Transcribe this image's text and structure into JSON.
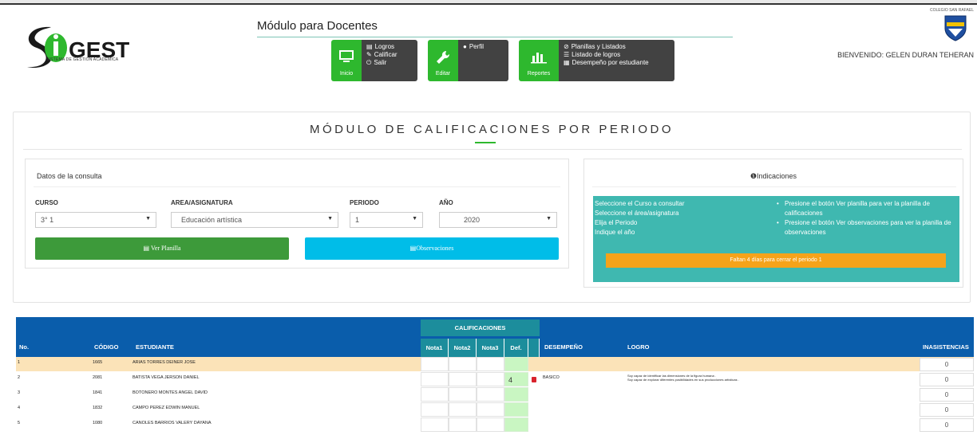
{
  "brand": {
    "logo_text": "SIGEST",
    "logo_sub": "SISTEMA DE GESTION ACADEMICA",
    "college": "COLEGIO SAN RAFAEL"
  },
  "header": {
    "module_title": "Módulo para Docentes",
    "welcome": "BIENVENIDO: GELEN DURAN TEHERAN"
  },
  "nav": {
    "inicio": {
      "label": "Inicio",
      "items": [
        "Logros",
        "Calificar",
        "Salir"
      ]
    },
    "editar": {
      "label": "Editar",
      "items": [
        "Perfil"
      ]
    },
    "reportes": {
      "label": "Reportes",
      "items": [
        "Planillas y Listados",
        "Listado de logros",
        "Desempeño por estudiante"
      ]
    }
  },
  "page": {
    "title": "MÓDULO DE CALIFICACIONES POR PERIODO"
  },
  "query": {
    "title": "Datos de la consulta",
    "curso_label": "CURSO",
    "curso_value": "3° 1",
    "area_label": "AREA/ASIGNATURA",
    "area_value": "Educación artística",
    "periodo_label": "PERIODO",
    "periodo_value": "1",
    "anio_label": "AÑO",
    "anio_value": "2020",
    "ver_planilla": "Ver Planilla",
    "observaciones": "Observaciones"
  },
  "indications": {
    "title": "Indicaciones",
    "left": [
      "Seleccione el Curso a consultar",
      "Seleccione el área/asignatura",
      "Elija el Periodo",
      "Indique el año"
    ],
    "right": [
      "Presione el botón Ver planilla para ver la planilla de calificaciones",
      "Presione el botón Ver observaciones para ver la planilla de observaciones"
    ],
    "alert": "Faltan 4 días para cerrar el periodo 1"
  },
  "table": {
    "calificaciones": "CALIFICACIONES",
    "headers": {
      "no": "No.",
      "codigo": "CÓDIGO",
      "estudiante": "ESTUDIANTE",
      "nota1": "Nota1",
      "nota2": "Nota2",
      "nota3": "Nota3",
      "def": "Def.",
      "desempeno": "DESEMPEÑO",
      "logro": "LOGRO",
      "inasistencias": "INASISTENCIAS"
    },
    "rows": [
      {
        "no": "1",
        "codigo": "1665",
        "estudiante": "ARIAS TORRES DEINER JOSE",
        "def": "",
        "desempeno": "",
        "logro1": "",
        "logro2": "",
        "inasistencias": "0"
      },
      {
        "no": "2",
        "codigo": "2081",
        "estudiante": "BATISTA VEGA JERSON DANIEL",
        "def": "4",
        "desempeno": "BASICO",
        "logro1": "Soy capaz de identificar las dimensiones de la figura humana .",
        "logro2": "Soy capaz de explorar diferentes posibilidades en sus producciones artísticas .",
        "inasistencias": "0"
      },
      {
        "no": "3",
        "codigo": "1841",
        "estudiante": "BOTONERO MONTES ANGEL DAVID",
        "def": "",
        "desempeno": "",
        "logro1": "",
        "logro2": "",
        "inasistencias": "0"
      },
      {
        "no": "4",
        "codigo": "1832",
        "estudiante": "CAMPO PEREZ EDWIN MANUEL",
        "def": "",
        "desempeno": "",
        "logro1": "",
        "logro2": "",
        "inasistencias": "0"
      },
      {
        "no": "5",
        "codigo": "1080",
        "estudiante": "CANOLES BARRIOS VALERY DAYANA",
        "def": "",
        "desempeno": "",
        "logro1": "",
        "logro2": "",
        "inasistencias": "0"
      }
    ]
  },
  "colors": {
    "accent_green": "#2eb82e",
    "nav_dark": "#424242",
    "table_header": "#0a5dab",
    "teal": "#3fb8b0",
    "orange": "#f5a31a",
    "cyan_button": "#00bde8"
  }
}
